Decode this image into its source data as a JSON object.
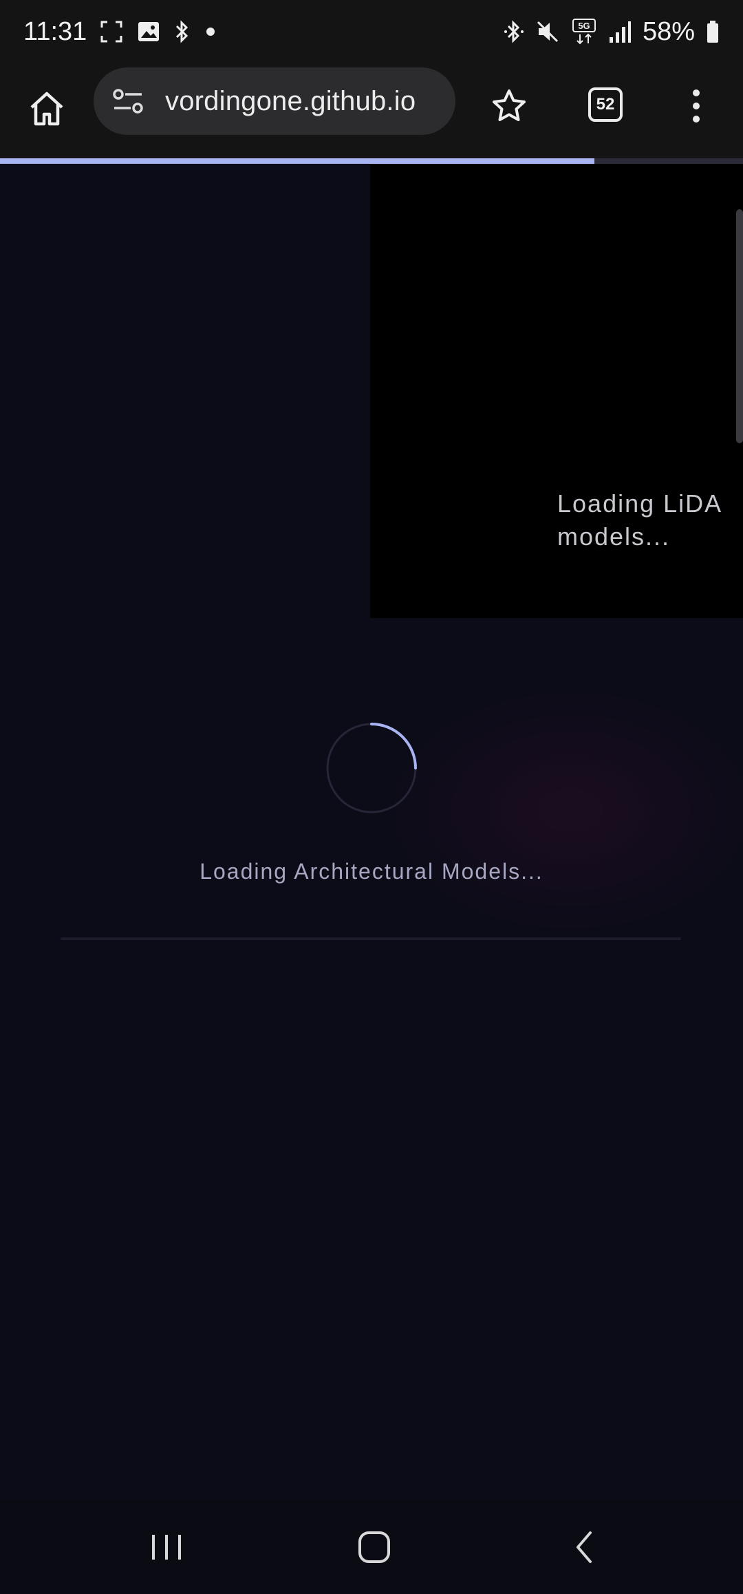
{
  "status_bar": {
    "time": "11:31",
    "battery": "58%",
    "network": "5G",
    "icons": [
      "screenshot-icon",
      "gallery-icon",
      "bluetooth-icon",
      "dot-icon",
      "bluetooth-icon",
      "mute-icon",
      "5g-icon",
      "signal-icon",
      "battery-icon"
    ]
  },
  "browser": {
    "url": "vordingone.github.io",
    "tab_count": "52",
    "load_progress": 0.8
  },
  "page": {
    "lida_loading": "Loading LiDA\nmodels...",
    "arch_loading": "Loading Architectural Models...",
    "spinner_accent": "#a9b4f2"
  },
  "colors": {
    "background": "#0c0c18",
    "panel": "#000000",
    "accent": "#a9b4f2",
    "muted_text": "#a7a7c2"
  }
}
